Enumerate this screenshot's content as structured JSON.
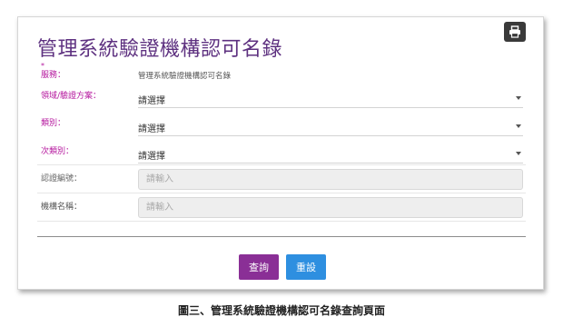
{
  "page": {
    "title": "管理系統驗證機構認可名錄",
    "caption": "圖三、管理系統驗證機構認可名錄查詢頁面"
  },
  "toolbar": {
    "print_icon": "print-icon"
  },
  "form": {
    "required_mark": "*",
    "service": {
      "label": "服務：",
      "value": "管理系統驗證機構認可名錄"
    },
    "domain_scheme": {
      "label": "領域/驗證方案：",
      "selected": "請選擇"
    },
    "category": {
      "label": "類別：",
      "selected": "請選擇"
    },
    "subcategory": {
      "label": "次類別：",
      "selected": "請選擇"
    },
    "cert_number": {
      "label": "認證編號：",
      "placeholder": "請輸入"
    },
    "org_name": {
      "label": "機構名稱：",
      "placeholder": "請輸入"
    }
  },
  "actions": {
    "query_label": "查詢",
    "reset_label": "重設"
  },
  "colors": {
    "title": "#5e3180",
    "label_required": "#b5179e",
    "query_button": "#8a2f96",
    "reset_button": "#2e8fe0",
    "print_button": "#3a3a3a"
  }
}
